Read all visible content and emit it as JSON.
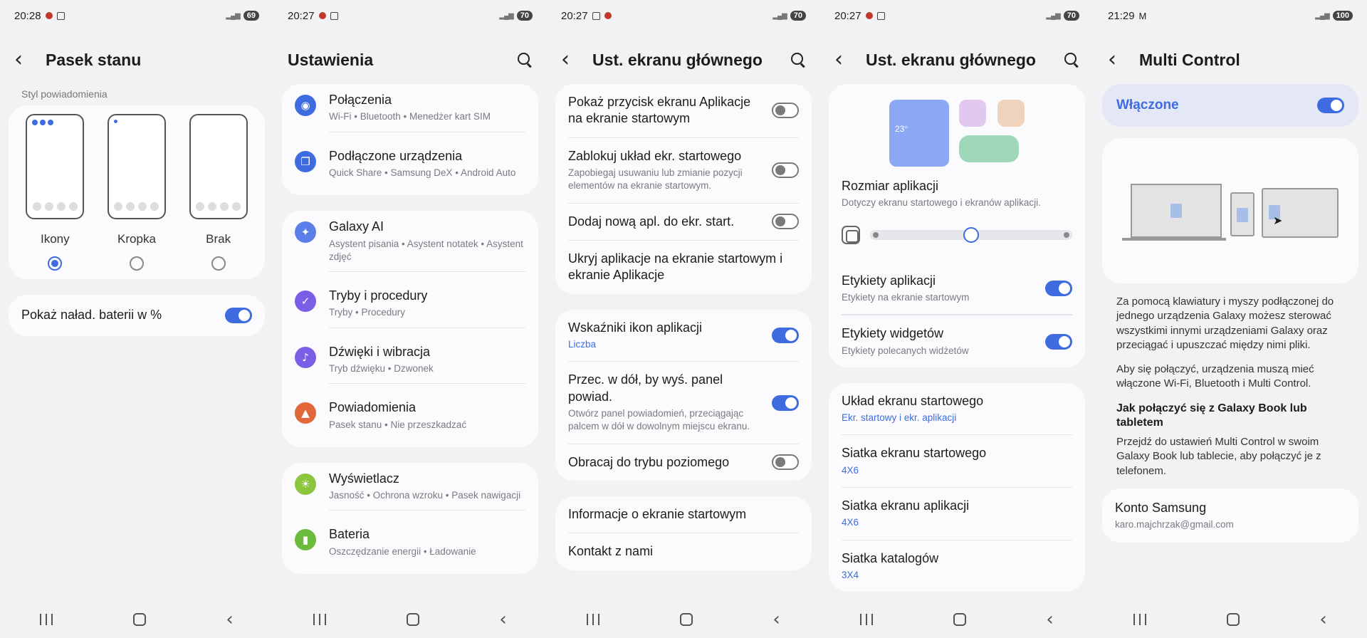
{
  "screens": [
    {
      "status": {
        "time": "20:28",
        "battery": "69"
      },
      "title": "Pasek stanu",
      "section_label": "Styl powiadomienia",
      "styles": [
        {
          "label": "Ikony",
          "selected": true
        },
        {
          "label": "Kropka",
          "selected": false
        },
        {
          "label": "Brak",
          "selected": false
        }
      ],
      "battery_toggle": {
        "label": "Pokaż naład. baterii w %",
        "on": true
      }
    },
    {
      "status": {
        "time": "20:27",
        "battery": "70"
      },
      "title": "Ustawienia",
      "groups": [
        [
          {
            "title": "Połączenia",
            "sub": "Wi-Fi  •  Bluetooth  •  Menedżer kart SIM",
            "icon": "wifi-icon",
            "color": "#3e6ce0",
            "glyph": "◉"
          },
          {
            "title": "Podłączone urządzenia",
            "sub": "Quick Share  •  Samsung DeX  •  Android Auto",
            "icon": "devices-icon",
            "color": "#3e6ce0",
            "glyph": "❐"
          }
        ],
        [
          {
            "title": "Galaxy AI",
            "sub": "Asystent pisania  •  Asystent notatek  •  Asystent zdjęć",
            "icon": "galaxy-ai-icon",
            "color": "#5b7fe8",
            "glyph": "✦"
          },
          {
            "title": "Tryby i procedury",
            "sub": "Tryby  •  Procedury",
            "icon": "modes-icon",
            "color": "#7b5ee6",
            "glyph": "✓"
          },
          {
            "title": "Dźwięki i wibracja",
            "sub": "Tryb dźwięku  •  Dzwonek",
            "icon": "sound-icon",
            "color": "#7b5ee6",
            "glyph": "♪"
          },
          {
            "title": "Powiadomienia",
            "sub": "Pasek stanu  •  Nie przeszkadzać",
            "icon": "bell-icon",
            "color": "#e0683a",
            "glyph": "▲"
          }
        ],
        [
          {
            "title": "Wyświetlacz",
            "sub": "Jasność  •  Ochrona wzroku  •  Pasek nawigacji",
            "icon": "display-icon",
            "color": "#8cc63f",
            "glyph": "☀"
          },
          {
            "title": "Bateria",
            "sub": "Oszczędzanie energii  •  Ładowanie",
            "icon": "battery-icon",
            "color": "#6cbb3c",
            "glyph": "▮"
          }
        ]
      ]
    },
    {
      "status": {
        "time": "20:27",
        "battery": "70"
      },
      "title": "Ust. ekranu głównego",
      "group1": [
        {
          "title": "Pokaż przycisk ekranu Aplikacje na ekranie startowym",
          "sub": "",
          "on": false
        },
        {
          "title": "Zablokuj układ ekr. startowego",
          "sub": "Zapobiegaj usuwaniu lub zmianie pozycji elementów na ekranie startowym.",
          "on": false
        },
        {
          "title": "Dodaj nową apl. do ekr. start.",
          "sub": "",
          "on": false
        },
        {
          "title": "Ukryj aplikacje na ekranie startowym i ekranie Aplikacje",
          "sub": "",
          "on": null
        }
      ],
      "group2": [
        {
          "title": "Wskaźniki ikon aplikacji",
          "sub": "Liczba",
          "sub_blue": true,
          "on": true
        },
        {
          "title": "Przec. w dół, by wyś. panel powiad.",
          "sub": "Otwórz panel powiadomień, przeciągając palcem w dół w dowolnym miejscu ekranu.",
          "sub_blue": false,
          "on": true
        },
        {
          "title": "Obracaj do trybu poziomego",
          "sub": "",
          "sub_blue": false,
          "on": false
        }
      ],
      "group3": [
        {
          "title": "Informacje o ekranie startowym"
        },
        {
          "title": "Kontakt z nami"
        }
      ]
    },
    {
      "status": {
        "time": "20:27",
        "battery": "70"
      },
      "title": "Ust. ekranu głównego",
      "preview_temp": "23°",
      "app_size": {
        "title": "Rozmiar aplikacji",
        "sub": "Dotyczy ekranu startowego i ekranów aplikacji.",
        "level": 0.5
      },
      "labels": [
        {
          "title": "Etykiety aplikacji",
          "sub": "Etykiety na ekranie startowym",
          "on": true
        },
        {
          "title": "Etykiety widgetów",
          "sub": "Etykiety polecanych widżetów",
          "on": true
        }
      ],
      "layout": [
        {
          "title": "Układ ekranu startowego",
          "sub": "Ekr. startowy i ekr. aplikacji"
        },
        {
          "title": "Siatka ekranu startowego",
          "sub": "4X6"
        },
        {
          "title": "Siatka ekranu aplikacji",
          "sub": "4X6"
        },
        {
          "title": "Siatka katalogów",
          "sub": "3X4"
        }
      ]
    },
    {
      "status": {
        "time": "21:29",
        "battery": "100"
      },
      "title": "Multi Control",
      "enabled_label": "Włączone",
      "enabled": true,
      "para1": "Za pomocą klawiatury i myszy podłączonej do jednego urządzenia Galaxy możesz sterować wszystkimi innymi urządzeniami Galaxy oraz przeciągać i upuszczać między nimi pliki.",
      "para2": "Aby się połączyć, urządzenia muszą mieć włączone Wi-Fi, Bluetooth i Multi Control.",
      "subheading": "Jak połączyć się z Galaxy Book lub tabletem",
      "para3": "Przejdź do ustawień Multi Control w swoim Galaxy Book lub tablecie, aby połączyć je z telefonem.",
      "account": {
        "title": "Konto Samsung",
        "email": "karo.majchrzak@gmail.com"
      }
    }
  ]
}
